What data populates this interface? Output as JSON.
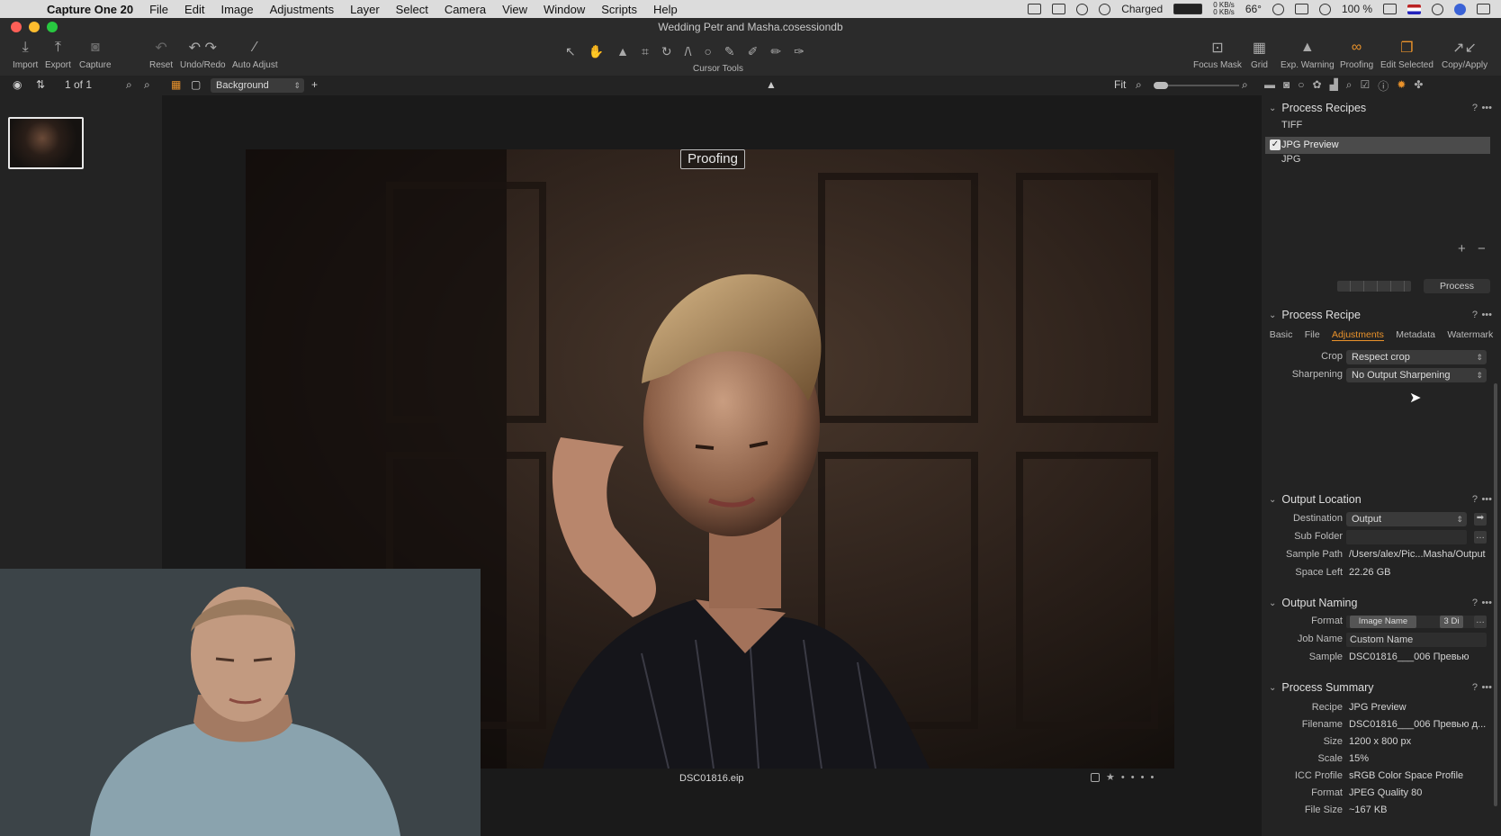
{
  "menubar": {
    "app_name": "Capture One 20",
    "items": [
      "File",
      "Edit",
      "Image",
      "Adjustments",
      "Layer",
      "Select",
      "Camera",
      "View",
      "Window",
      "Scripts",
      "Help"
    ],
    "status": {
      "battery_text": "Charged",
      "net_up": "0 KB/s",
      "net_down": "0 KB/s",
      "temp": "66°",
      "battery_pct": "100 %"
    }
  },
  "titlebar": {
    "title": "Wedding Petr and Masha.cosessiondb"
  },
  "toolbar": {
    "left": [
      {
        "label": "Import",
        "icon": "import-icon"
      },
      {
        "label": "Export",
        "icon": "export-icon"
      },
      {
        "label": "Capture",
        "icon": "camera-icon"
      },
      {
        "label": "Reset",
        "icon": "reset-icon"
      },
      {
        "label": "Undo/Redo",
        "icon": "undo-redo-icon"
      },
      {
        "label": "Auto Adjust",
        "icon": "magic-wand-icon"
      }
    ],
    "cursor_tools_label": "Cursor Tools",
    "right": [
      {
        "label": "Focus Mask",
        "icon": "focus-mask-icon"
      },
      {
        "label": "Grid",
        "icon": "grid-icon"
      },
      {
        "label": "Exp. Warning",
        "icon": "warning-icon"
      },
      {
        "label": "Proofing",
        "icon": "glasses-icon"
      },
      {
        "label": "Edit Selected",
        "icon": "edit-selected-icon"
      },
      {
        "label": "Copy/Apply",
        "icon": "copy-apply-icon"
      }
    ]
  },
  "subbar": {
    "count": "1 of 1",
    "background_select": "Background",
    "zoom_label": "Fit"
  },
  "viewer": {
    "proof_label": "Proofing",
    "filename": "DSC01816.eip"
  },
  "recipes": {
    "title": "Process Recipes",
    "items": [
      {
        "label": "TIFF",
        "checked": false
      },
      {
        "label": "JPG Preview",
        "checked": true
      },
      {
        "label": "JPG",
        "checked": false
      }
    ],
    "process_button": "Process"
  },
  "recipe": {
    "title": "Process Recipe",
    "tabs": [
      "Basic",
      "File",
      "Adjustments",
      "Metadata",
      "Watermark"
    ],
    "active_tab": "Adjustments",
    "crop_label": "Crop",
    "crop_value": "Respect crop",
    "sharpening_label": "Sharpening",
    "sharpening_value": "No Output Sharpening"
  },
  "output_location": {
    "title": "Output Location",
    "destination_label": "Destination",
    "destination_value": "Output",
    "subfolder_label": "Sub Folder",
    "sample_path_label": "Sample Path",
    "sample_path_value": "/Users/alex/Pic...Masha/Output",
    "space_left_label": "Space Left",
    "space_left_value": "22.26 GB"
  },
  "output_naming": {
    "title": "Output Naming",
    "format_label": "Format",
    "format_token1": "Image Name",
    "format_token2": "3 Di",
    "job_name_label": "Job Name",
    "job_name_value": "Custom Name",
    "sample_label": "Sample",
    "sample_value": "DSC01816___006 Превью"
  },
  "summary": {
    "title": "Process Summary",
    "rows": [
      {
        "k": "Recipe",
        "v": "JPG Preview"
      },
      {
        "k": "Filename",
        "v": "DSC01816___006 Превью д..."
      },
      {
        "k": "Size",
        "v": "1200 x 800 px"
      },
      {
        "k": "Scale",
        "v": "15%"
      },
      {
        "k": "ICC Profile",
        "v": "sRGB Color Space Profile"
      },
      {
        "k": "Format",
        "v": "JPEG Quality 80"
      },
      {
        "k": "File Size",
        "v": "~167 KB"
      }
    ]
  },
  "colors": {
    "accent": "#e9922b",
    "panel": "#232323",
    "toolbar": "#2b2b2b"
  }
}
